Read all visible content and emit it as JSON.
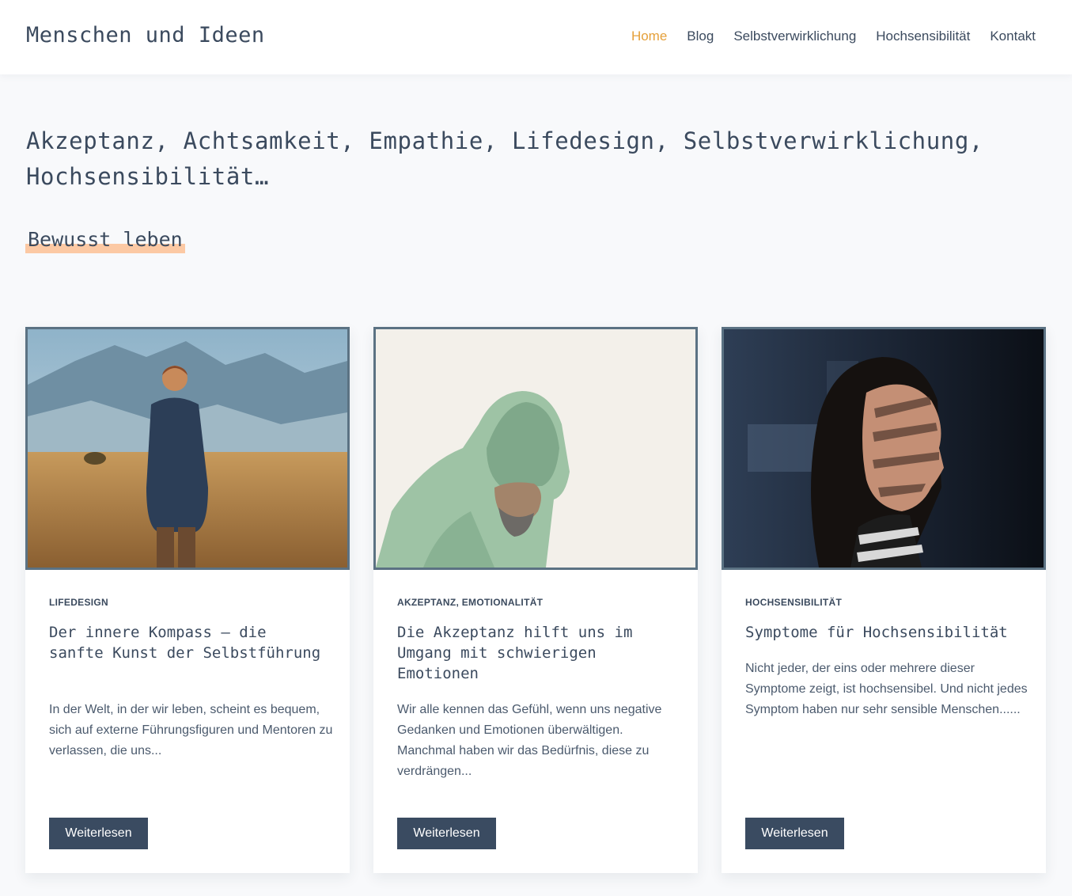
{
  "header": {
    "site_title": "Menschen und Ideen",
    "nav": [
      {
        "label": "Home",
        "active": true
      },
      {
        "label": "Blog"
      },
      {
        "label": "Selbstverwirklichung"
      },
      {
        "label": "Hochsensibilität"
      },
      {
        "label": "Kontakt"
      }
    ]
  },
  "hero": {
    "heading": "Akzeptanz, Achtsamkeit, Empathie, Lifedesign, Selbstverwirklichung, Hochsensibilität…",
    "subtitle": "Bewusst leben",
    "highlight_color": "#fcc9a4"
  },
  "colors": {
    "accent": "#e5a03a",
    "text": "#3b4a5e",
    "button": "#3a4b61",
    "image_border": "#5b7283"
  },
  "posts": [
    {
      "image": "man-in-field-photo",
      "category": "LIFEDESIGN",
      "title": "Der innere Kompass – die sanfte Kunst der Selbstführung",
      "excerpt": "In der Welt, in der wir leben, scheint es bequem, sich auf externe Führungsfiguren und Mentoren zu verlassen, die uns...",
      "button": "Weiterlesen"
    },
    {
      "image": "man-in-green-hoodie-photo",
      "category": "AKZEPTANZ, EMOTIONALITÄT",
      "title": "Die Akzeptanz hilft uns im Umgang mit schwierigen Emotionen",
      "excerpt": "Wir alle kennen das Gefühl, wenn uns negative Gedanken und Emotionen überwältigen. Manchmal haben wir das Bedürfnis, diese zu verdrängen...",
      "button": "Weiterlesen"
    },
    {
      "image": "woman-shadow-profile-photo",
      "category": "HOCHSENSIBILITÄT",
      "title": "Symptome für Hochsensibilität",
      "excerpt": "Nicht jeder, der eins oder mehrere dieser Symptome zeigt, ist hochsensibel. Und nicht jedes Symptom haben nur sehr sensible Menschen......",
      "button": "Weiterlesen"
    }
  ]
}
